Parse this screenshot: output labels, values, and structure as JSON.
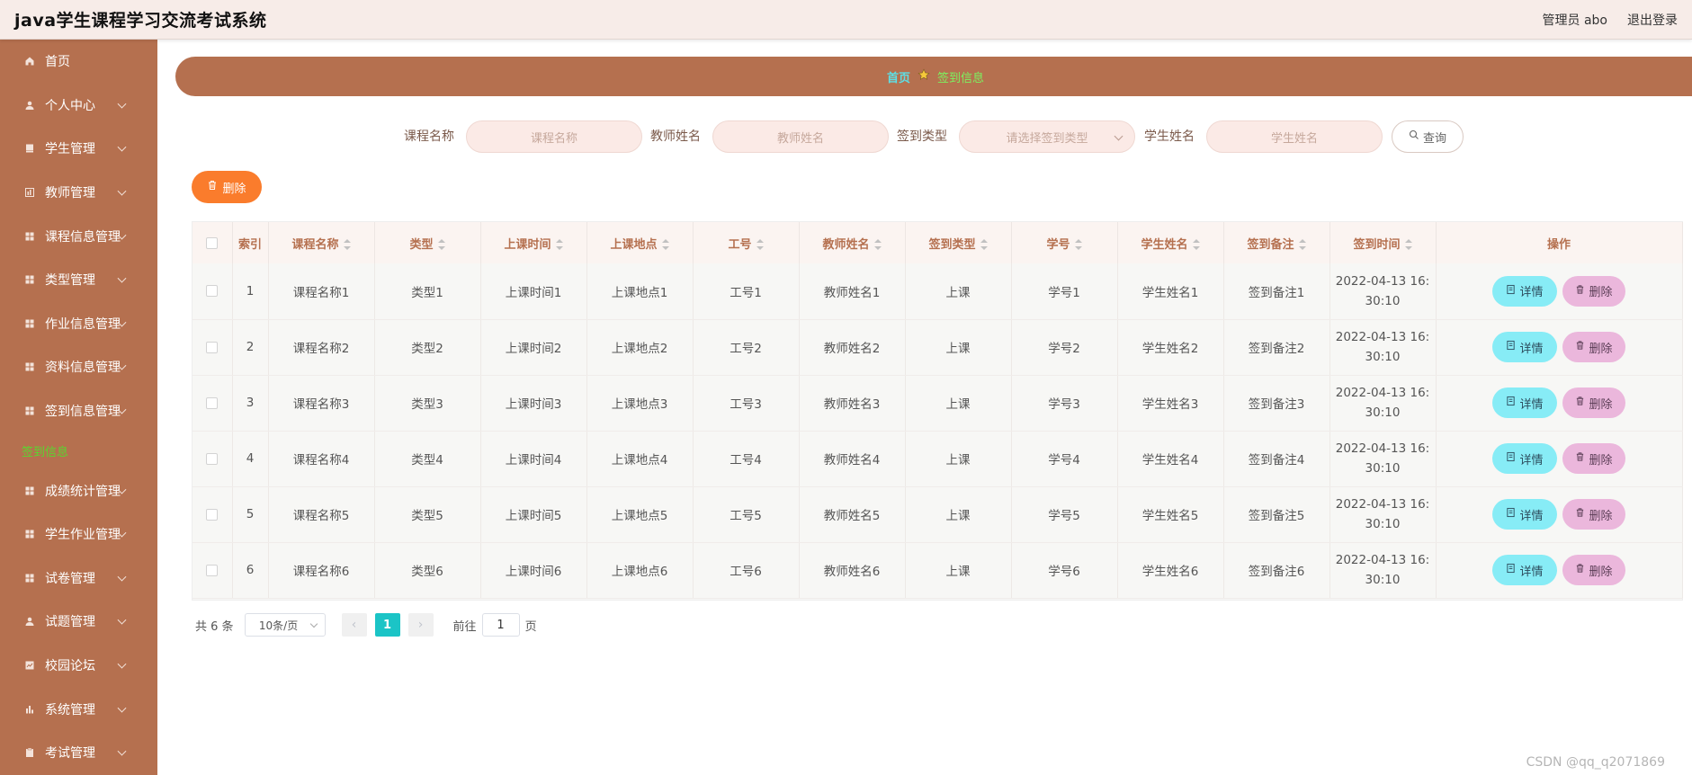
{
  "header": {
    "title": "java学生课程学习交流考试系统",
    "admin_label": "管理员 abo",
    "logout_label": "退出登录"
  },
  "sidebar": {
    "items": [
      {
        "label": "首页",
        "icon": "home-icon",
        "expandable": false
      },
      {
        "label": "个人中心",
        "icon": "user-icon",
        "expandable": true
      },
      {
        "label": "学生管理",
        "icon": "book-icon",
        "expandable": true
      },
      {
        "label": "教师管理",
        "icon": "chart-icon",
        "expandable": true
      },
      {
        "label": "课程信息管理",
        "icon": "grid-icon",
        "expandable": true
      },
      {
        "label": "类型管理",
        "icon": "grid-icon",
        "expandable": true
      },
      {
        "label": "作业信息管理",
        "icon": "grid-icon",
        "expandable": true
      },
      {
        "label": "资料信息管理",
        "icon": "grid-icon",
        "expandable": true
      },
      {
        "label": "签到信息管理",
        "icon": "grid-icon",
        "expandable": true
      },
      {
        "label": "签到信息",
        "icon": "",
        "expandable": false,
        "plain": true
      },
      {
        "label": "成绩统计管理",
        "icon": "grid-icon",
        "expandable": true
      },
      {
        "label": "学生作业管理",
        "icon": "grid-icon",
        "expandable": true
      },
      {
        "label": "试卷管理",
        "icon": "grid-icon",
        "expandable": true
      },
      {
        "label": "试题管理",
        "icon": "user-icon",
        "expandable": true
      },
      {
        "label": "校园论坛",
        "icon": "chart-line-icon",
        "expandable": true
      },
      {
        "label": "系统管理",
        "icon": "bar-chart-icon",
        "expandable": true
      },
      {
        "label": "考试管理",
        "icon": "clipboard-icon",
        "expandable": true
      }
    ]
  },
  "breadcrumb": {
    "home": "首页",
    "current": "签到信息"
  },
  "search": {
    "course_name_label": "课程名称",
    "course_name_placeholder": "课程名称",
    "teacher_name_label": "教师姓名",
    "teacher_name_placeholder": "教师姓名",
    "checkin_type_label": "签到类型",
    "checkin_type_placeholder": "请选择签到类型",
    "student_name_label": "学生姓名",
    "student_name_placeholder": "学生姓名",
    "query_label": "查询"
  },
  "toolbar": {
    "delete_label": "删除"
  },
  "table": {
    "columns": [
      "索引",
      "课程名称",
      "类型",
      "上课时间",
      "上课地点",
      "工号",
      "教师姓名",
      "签到类型",
      "学号",
      "学生姓名",
      "签到备注",
      "签到时间",
      "操作"
    ],
    "rows": [
      {
        "index": "1",
        "course": "课程名称1",
        "type": "类型1",
        "time": "上课时间1",
        "place": "上课地点1",
        "job_no": "工号1",
        "teacher": "教师姓名1",
        "checkin_type": "上课",
        "student_no": "学号1",
        "student": "学生姓名1",
        "remark": "签到备注1",
        "checkin_time_1": "2022-04-13 16:",
        "checkin_time_2": "30:10"
      },
      {
        "index": "2",
        "course": "课程名称2",
        "type": "类型2",
        "time": "上课时间2",
        "place": "上课地点2",
        "job_no": "工号2",
        "teacher": "教师姓名2",
        "checkin_type": "上课",
        "student_no": "学号2",
        "student": "学生姓名2",
        "remark": "签到备注2",
        "checkin_time_1": "2022-04-13 16:",
        "checkin_time_2": "30:10"
      },
      {
        "index": "3",
        "course": "课程名称3",
        "type": "类型3",
        "time": "上课时间3",
        "place": "上课地点3",
        "job_no": "工号3",
        "teacher": "教师姓名3",
        "checkin_type": "上课",
        "student_no": "学号3",
        "student": "学生姓名3",
        "remark": "签到备注3",
        "checkin_time_1": "2022-04-13 16:",
        "checkin_time_2": "30:10"
      },
      {
        "index": "4",
        "course": "课程名称4",
        "type": "类型4",
        "time": "上课时间4",
        "place": "上课地点4",
        "job_no": "工号4",
        "teacher": "教师姓名4",
        "checkin_type": "上课",
        "student_no": "学号4",
        "student": "学生姓名4",
        "remark": "签到备注4",
        "checkin_time_1": "2022-04-13 16:",
        "checkin_time_2": "30:10"
      },
      {
        "index": "5",
        "course": "课程名称5",
        "type": "类型5",
        "time": "上课时间5",
        "place": "上课地点5",
        "job_no": "工号5",
        "teacher": "教师姓名5",
        "checkin_type": "上课",
        "student_no": "学号5",
        "student": "学生姓名5",
        "remark": "签到备注5",
        "checkin_time_1": "2022-04-13 16:",
        "checkin_time_2": "30:10"
      },
      {
        "index": "6",
        "course": "课程名称6",
        "type": "类型6",
        "time": "上课时间6",
        "place": "上课地点6",
        "job_no": "工号6",
        "teacher": "教师姓名6",
        "checkin_type": "上课",
        "student_no": "学号6",
        "student": "学生姓名6",
        "remark": "签到备注6",
        "checkin_time_1": "2022-04-13 16:",
        "checkin_time_2": "30:10"
      }
    ],
    "detail_label": "详情",
    "delete_label": "删除"
  },
  "pagination": {
    "total": "共 6 条",
    "page_size": "10条/页",
    "current_page": "1",
    "goto_prefix": "前往",
    "goto_value": "1",
    "goto_suffix": "页"
  },
  "watermark": "CSDN @qq_q2071869",
  "colors": {
    "sidebar": "#b5704f",
    "header": "#f7ece8",
    "accent_orange": "#fa7c2c",
    "detail_btn": "#87ecf6",
    "delete_btn": "#ebb7dc",
    "page_active": "#1bc4c6",
    "table_header_text": "#b5704f"
  }
}
